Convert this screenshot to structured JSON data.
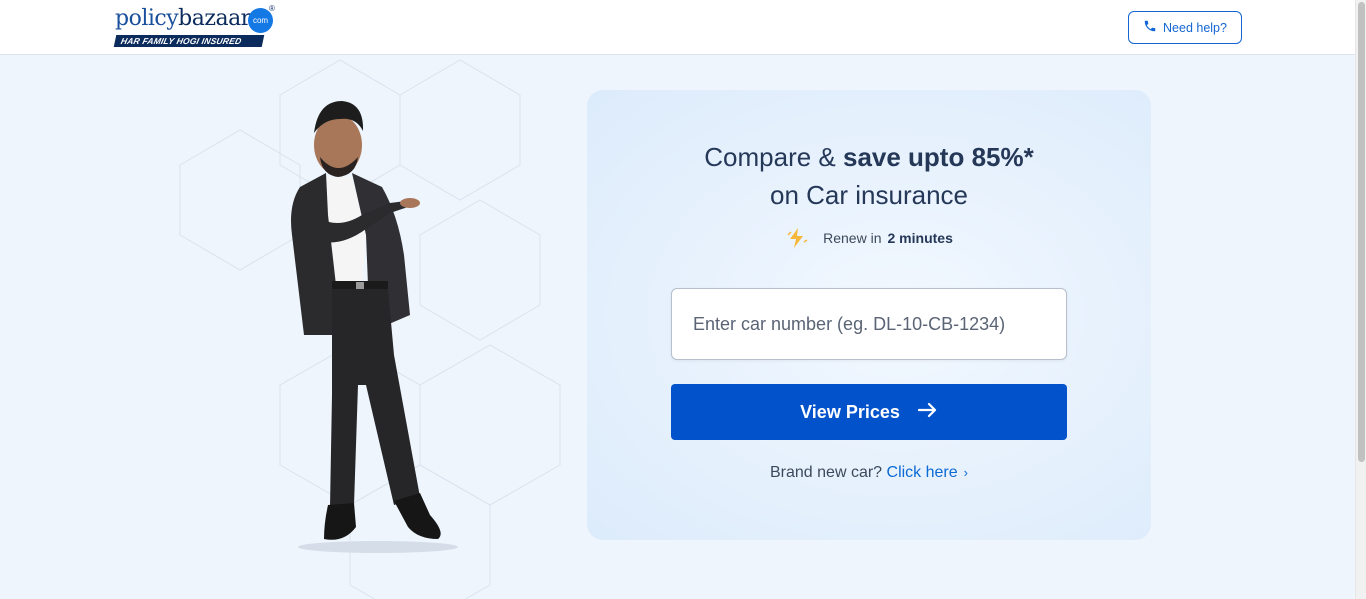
{
  "header": {
    "logo_text_1": "policy",
    "logo_text_2": "bazaar",
    "logo_badge": "com",
    "logo_reg": "®",
    "tagline": "HAR FAMILY HOGI INSURED",
    "help_label": "Need help?"
  },
  "card": {
    "headline_prefix": "Compare & ",
    "headline_strong": "save upto 85%*",
    "headline_line2": "on Car insurance",
    "renew_prefix": "Renew in",
    "renew_strong": "2 minutes",
    "input_placeholder": "Enter car number (eg. DL-10-CB-1234)",
    "input_value": "",
    "cta_label": "View Prices",
    "brand_new_text": "Brand new car?",
    "brand_new_link": "Click here"
  },
  "colors": {
    "primary": "#0252cc",
    "link": "#0b6ad4",
    "background": "#eef5fd",
    "text": "#253858"
  },
  "icons": [
    "phone-icon",
    "lightning-icon",
    "arrow-right-icon",
    "chevron-right-icon"
  ]
}
